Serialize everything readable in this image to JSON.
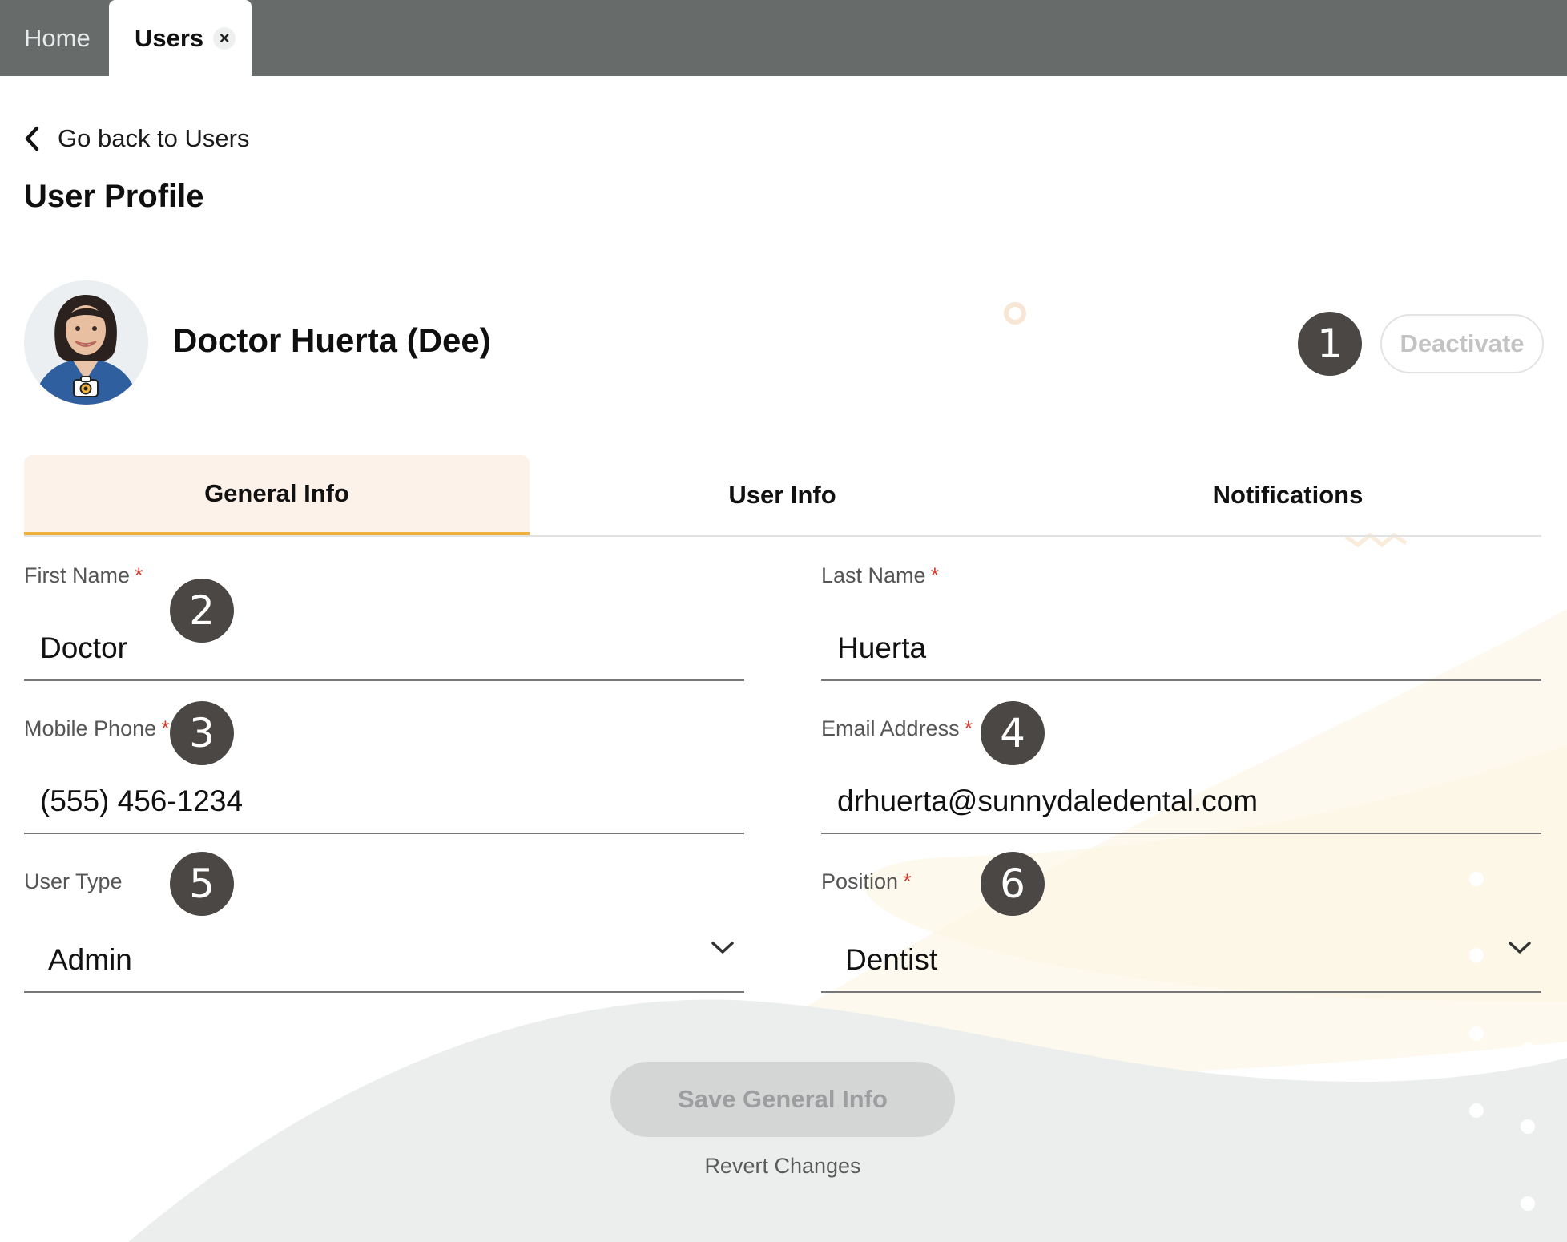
{
  "top_tabs": {
    "home": "Home",
    "users": "Users",
    "close_symbol": "×"
  },
  "back_link": "Go back to Users",
  "page_title": "User Profile",
  "profile": {
    "name": "Doctor Huerta (Dee)"
  },
  "deactivate_label": "Deactivate",
  "section_tabs": [
    "General Info",
    "User Info",
    "Notifications"
  ],
  "active_section_tab": "General Info",
  "form": {
    "first_name": {
      "label": "First Name",
      "value": "Doctor",
      "required_mark": "*"
    },
    "last_name": {
      "label": "Last Name",
      "value": "Huerta",
      "required_mark": "*"
    },
    "mobile_phone": {
      "label": "Mobile Phone",
      "value": "(555) 456-1234",
      "required_mark": "*"
    },
    "email": {
      "label": "Email Address",
      "value": "drhuerta@sunnydaledental.com",
      "required_mark": "*"
    },
    "user_type": {
      "label": "User Type",
      "value": "Admin"
    },
    "position": {
      "label": "Position",
      "value": "Dentist",
      "required_mark": "*"
    }
  },
  "callouts": [
    "1",
    "2",
    "3",
    "4",
    "5",
    "6"
  ],
  "save_label": "Save General Info",
  "revert_label": "Revert Changes",
  "colors": {
    "topbar": "#676c6b",
    "accent": "#f1b23c",
    "active_tab_bg": "#fdf2e9",
    "badge": "#4a4745",
    "required": "#d23b30"
  }
}
